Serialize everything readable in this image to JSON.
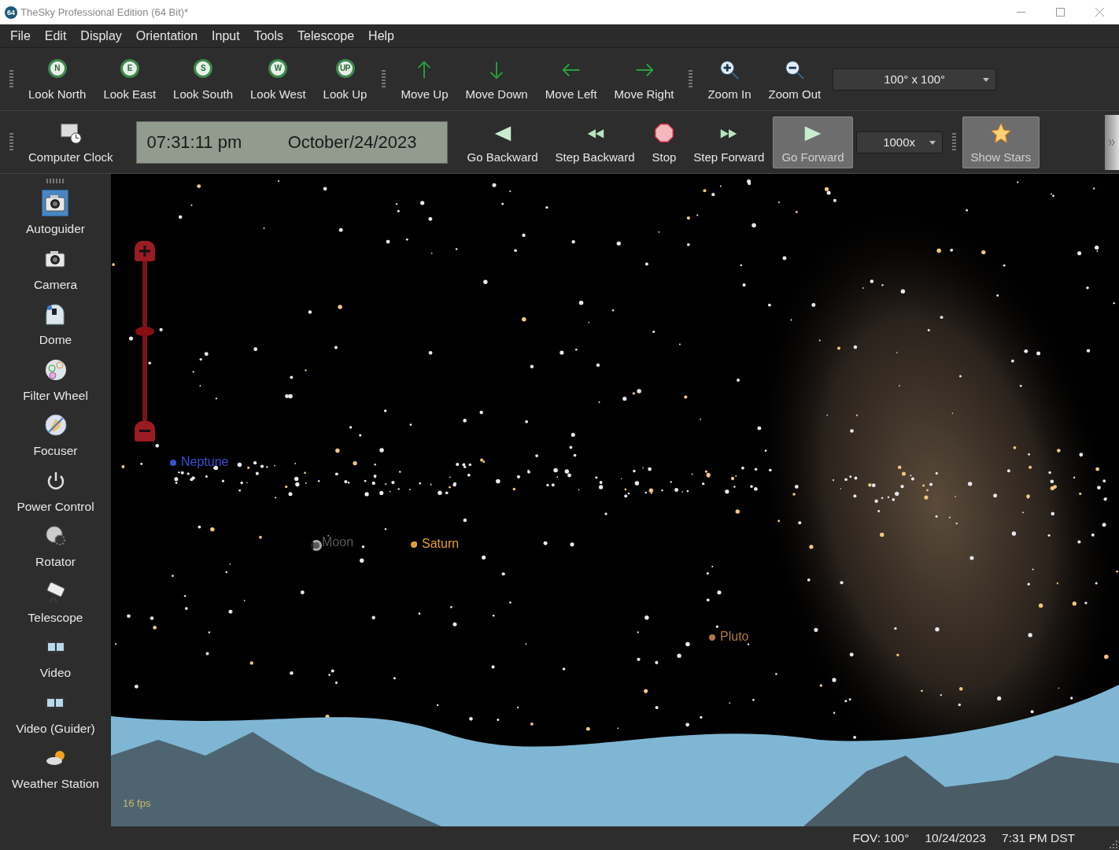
{
  "window": {
    "title": "TheSky Professional Edition (64 Bit)*",
    "app_badge": "64"
  },
  "menu": [
    "File",
    "Edit",
    "Display",
    "Orientation",
    "Input",
    "Tools",
    "Telescope",
    "Help"
  ],
  "toolbar_1": [
    {
      "kind": "look",
      "label": "Look North",
      "badge": "N"
    },
    {
      "kind": "look",
      "label": "Look East",
      "badge": "E"
    },
    {
      "kind": "look",
      "label": "Look South",
      "badge": "S"
    },
    {
      "kind": "look",
      "label": "Look West",
      "badge": "W"
    },
    {
      "kind": "look",
      "label": "Look Up",
      "badge": "UP"
    },
    {
      "kind": "grip"
    },
    {
      "kind": "arrow-up",
      "label": "Move Up"
    },
    {
      "kind": "arrow-down",
      "label": "Move Down"
    },
    {
      "kind": "arrow-left",
      "label": "Move Left"
    },
    {
      "kind": "arrow-right",
      "label": "Move Right"
    },
    {
      "kind": "grip"
    },
    {
      "kind": "zoom-in",
      "label": "Zoom In"
    },
    {
      "kind": "zoom-out",
      "label": "Zoom Out"
    },
    {
      "kind": "dropdown",
      "value": "100° x 100°"
    }
  ],
  "toolbar_2": [
    {
      "kind": "clock",
      "label": "Computer Clock",
      "pressed": false
    },
    {
      "kind": "time-display",
      "time": "07:31:11 pm",
      "date": "October/24/2023"
    },
    {
      "kind": "go-backward",
      "label": "Go Backward",
      "pressed": false
    },
    {
      "kind": "step-backward",
      "label": "Step Backward",
      "pressed": false
    },
    {
      "kind": "stop",
      "label": "Stop",
      "pressed": false
    },
    {
      "kind": "step-forward",
      "label": "Step Forward",
      "pressed": false
    },
    {
      "kind": "go-forward",
      "label": "Go Forward",
      "pressed": true
    },
    {
      "kind": "dropdown",
      "value": "1000x"
    },
    {
      "kind": "grip"
    },
    {
      "kind": "show-stars",
      "label": "Show Stars",
      "pressed": true
    }
  ],
  "sidebar": {
    "items": [
      {
        "kind": "camera",
        "label": "Autoguider",
        "selected": true
      },
      {
        "kind": "camera",
        "label": "Camera",
        "selected": false
      },
      {
        "kind": "dome",
        "label": "Dome",
        "selected": false
      },
      {
        "kind": "filter",
        "label": "Filter Wheel",
        "selected": false
      },
      {
        "kind": "focuser",
        "label": "Focuser",
        "selected": false
      },
      {
        "kind": "power",
        "label": "Power Control",
        "selected": false
      },
      {
        "kind": "rotator",
        "label": "Rotator",
        "selected": false
      },
      {
        "kind": "telescope",
        "label": "Telescope",
        "selected": false
      },
      {
        "kind": "video",
        "label": "Video",
        "selected": false
      },
      {
        "kind": "video",
        "label": "Video (Guider)",
        "selected": false
      },
      {
        "kind": "weather",
        "label": "Weather Station",
        "selected": false
      }
    ]
  },
  "sky": {
    "zoom_slider": {
      "level": 0.56
    },
    "objects": [
      {
        "kind": "planet",
        "name": "Neptune",
        "color": "#3a4fd0"
      },
      {
        "kind": "moon",
        "name": "Moon",
        "color": "#5a5a5a"
      },
      {
        "kind": "planet",
        "name": "Saturn",
        "color": "#e0a030"
      },
      {
        "kind": "planet",
        "name": "Pluto",
        "color": "#b07840"
      }
    ],
    "fps": "16 fps"
  },
  "status_bar": [
    "FOV: 100°",
    "10/24/2023",
    "7:31 PM DST"
  ]
}
